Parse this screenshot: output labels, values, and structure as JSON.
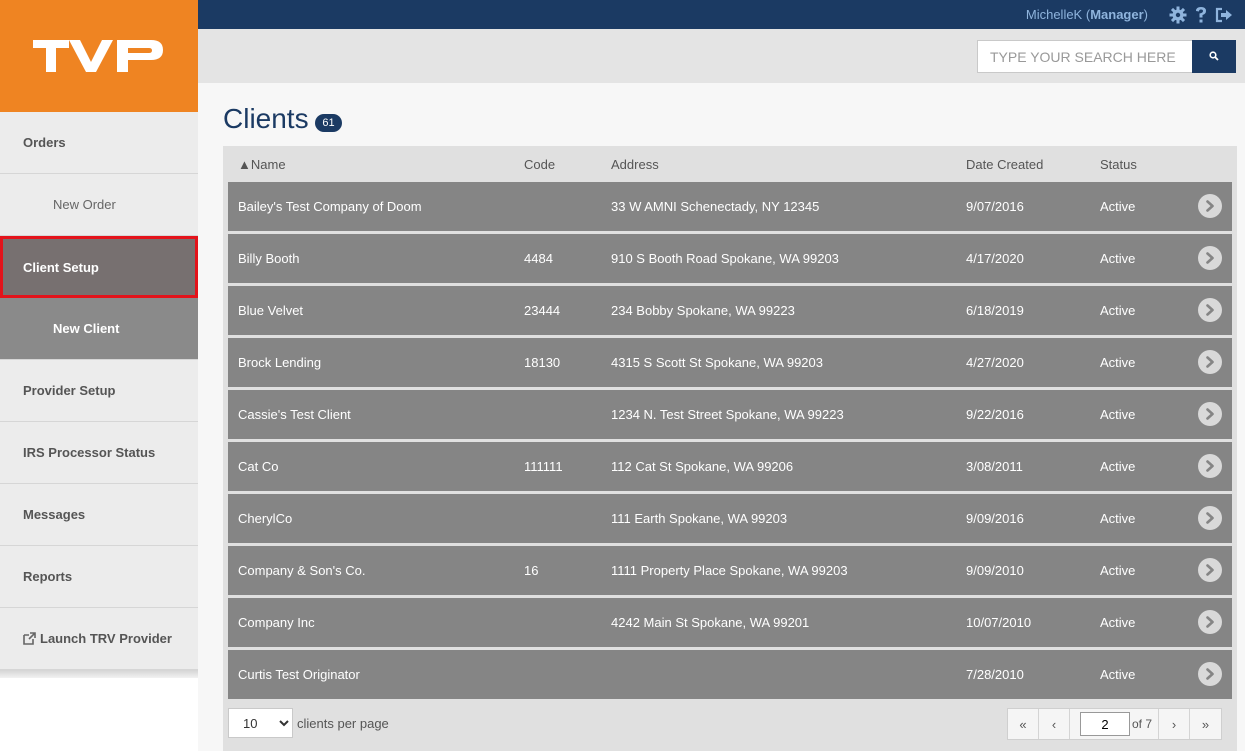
{
  "logo": {
    "text": "TVP"
  },
  "user": {
    "name": "MichelleK",
    "role": "Manager"
  },
  "icons": {
    "settings": "gear-icon",
    "help": "help-icon",
    "logout": "logout-icon",
    "search": "search-icon"
  },
  "colors": {
    "brand_orange": "#ef8422",
    "navy": "#1b3a63",
    "row_bg": "#858585",
    "active_outline": "#e3131b"
  },
  "sidebar": {
    "items": [
      {
        "label": "Orders"
      },
      {
        "label": "New Order"
      },
      {
        "label": "Client Setup"
      },
      {
        "label": "New Client"
      },
      {
        "label": "Provider Setup"
      },
      {
        "label": "IRS Processor Status"
      },
      {
        "label": "Messages"
      },
      {
        "label": "Reports"
      },
      {
        "label": "Launch TRV Provider"
      }
    ]
  },
  "search": {
    "placeholder": "TYPE YOUR SEARCH HERE"
  },
  "page": {
    "title": "Clients",
    "count": "61"
  },
  "table": {
    "columns": {
      "name": "Name",
      "code": "Code",
      "address": "Address",
      "date": "Date Created",
      "status": "Status"
    },
    "sort_indicator": "▲",
    "rows": [
      {
        "name": "Bailey's Test Company of Doom",
        "code": "",
        "address": "33 W AMNI Schenectady, NY 12345",
        "date": "9/07/2016",
        "status": "Active"
      },
      {
        "name": "Billy Booth",
        "code": "4484",
        "address": "910 S Booth Road Spokane, WA 99203",
        "date": "4/17/2020",
        "status": "Active"
      },
      {
        "name": "Blue Velvet",
        "code": "23444",
        "address": "234 Bobby Spokane, WA 99223",
        "date": "6/18/2019",
        "status": "Active"
      },
      {
        "name": "Brock Lending",
        "code": "18130",
        "address": "4315 S Scott St Spokane, WA 99203",
        "date": "4/27/2020",
        "status": "Active"
      },
      {
        "name": "Cassie's Test Client",
        "code": "",
        "address": "1234 N. Test Street Spokane, WA 99223",
        "date": "9/22/2016",
        "status": "Active"
      },
      {
        "name": "Cat Co",
        "code": "111111",
        "address": "112 Cat St Spokane, WA 99206",
        "date": "3/08/2011",
        "status": "Active"
      },
      {
        "name": "CherylCo",
        "code": "",
        "address": "111 Earth Spokane, WA 99203",
        "date": "9/09/2016",
        "status": "Active"
      },
      {
        "name": "Company & Son's Co.",
        "code": "16",
        "address": "1111 Property Place Spokane, WA 99203",
        "date": "9/09/2010",
        "status": "Active"
      },
      {
        "name": "Company Inc",
        "code": "",
        "address": "4242 Main St Spokane, WA 99201",
        "date": "10/07/2010",
        "status": "Active"
      },
      {
        "name": "Curtis Test Originator",
        "code": "",
        "address": "",
        "date": "7/28/2010",
        "status": "Active"
      }
    ]
  },
  "pagination": {
    "per_page_value": "10",
    "per_page_label": "clients per page",
    "first": "«",
    "prev": "‹",
    "current_page": "2",
    "of_label": "of 7",
    "next": "›",
    "last": "»"
  }
}
